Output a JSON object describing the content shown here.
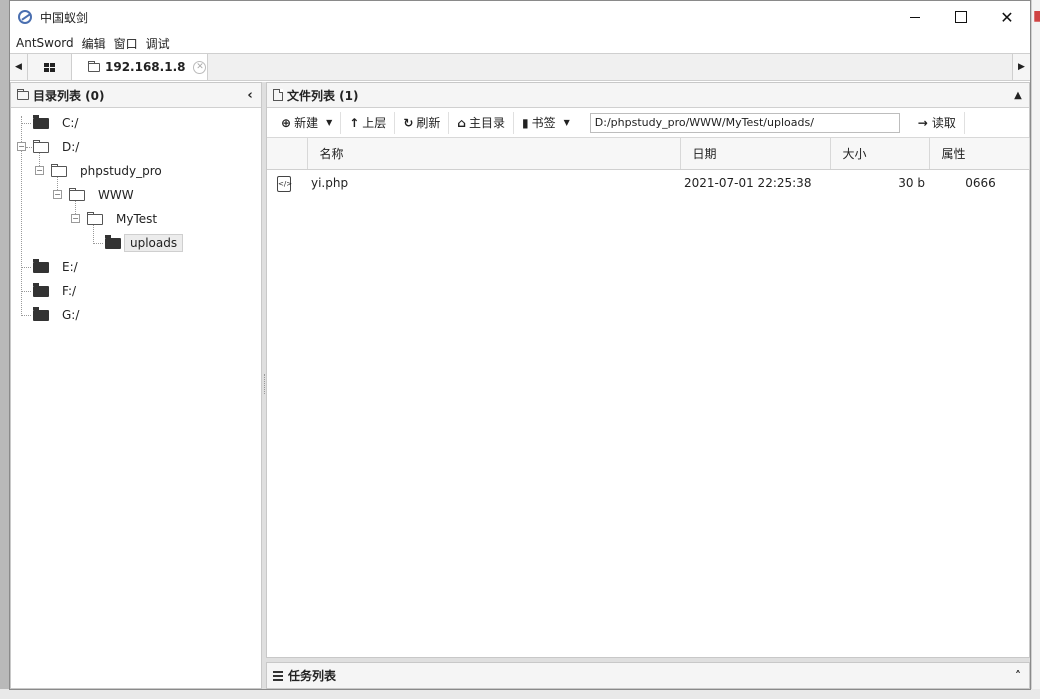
{
  "window": {
    "title": "中国蚁剑"
  },
  "menu": [
    "AntSword",
    "编辑",
    "窗口",
    "调试"
  ],
  "tabs": {
    "active_label": "192.168.1.8"
  },
  "dir_panel": {
    "title": "目录列表 (0)",
    "tree": [
      {
        "label": "C:/"
      },
      {
        "label": "D:/"
      },
      {
        "label": "phpstudy_pro"
      },
      {
        "label": "WWW"
      },
      {
        "label": "MyTest"
      },
      {
        "label": "uploads"
      },
      {
        "label": "E:/"
      },
      {
        "label": "F:/"
      },
      {
        "label": "G:/"
      }
    ]
  },
  "file_panel": {
    "title": "文件列表 (1)",
    "toolbar": {
      "new_label": "新建",
      "up_label": "上层",
      "refresh_label": "刷新",
      "home_label": "主目录",
      "bookmark_label": "书签",
      "path_value": "D:/phpstudy_pro/WWW/MyTest/uploads/",
      "read_label": "读取"
    },
    "columns": [
      "名称",
      "日期",
      "大小",
      "属性"
    ],
    "rows": [
      {
        "name": "yi.php",
        "date": "2021-07-01 22:25:38",
        "size": "30 b",
        "attr": "0666"
      }
    ]
  },
  "task_panel": {
    "title": "任务列表"
  }
}
